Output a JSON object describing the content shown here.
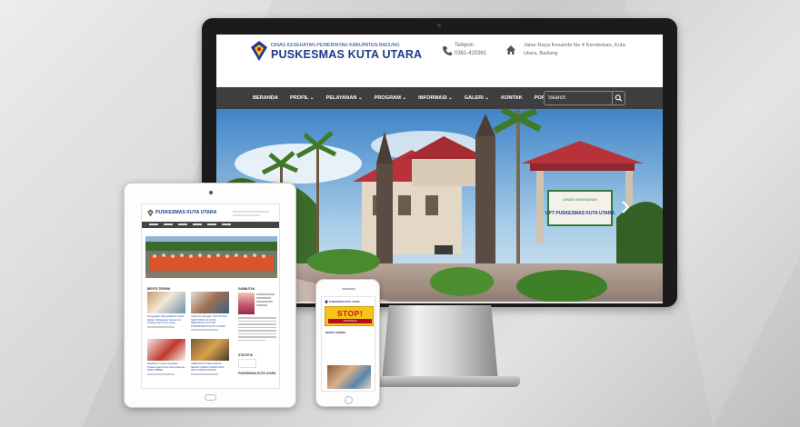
{
  "colors": {
    "brand_blue": "#1f3b88",
    "nav_bg": "#3e3e3e",
    "roof_red": "#b8323a",
    "stop_yellow": "#f2c41c",
    "stop_red": "#c8141c"
  },
  "desktop": {
    "header": {
      "kicker": "DINAS KESEHATAN PEMERINTAH KABUPATEN BADUNG",
      "title": "PUSKESMAS KUTA UTARA",
      "phone_label": "Telepon",
      "phone_number": "0361-425981",
      "address_line1": "Jalan Raya Kesambi No 4 Kerobokan, Kuta",
      "address_line2": "Utara, Badung",
      "phone_icon": "phone-icon",
      "address_icon": "home-icon"
    },
    "nav": {
      "items": [
        {
          "label": "BERANDA"
        },
        {
          "label": "PROFIL ⌄"
        },
        {
          "label": "PELAYANAN ⌄"
        },
        {
          "label": "PROGRAM ⌄"
        },
        {
          "label": "INFORMASI ⌄"
        },
        {
          "label": "GALERI ⌄"
        },
        {
          "label": "KONTAK"
        },
        {
          "label": "PORTAL"
        }
      ],
      "search_placeholder": "Search",
      "search_icon": "search-icon"
    },
    "hero": {
      "next_icon": "chevron-right-icon",
      "sign_top": "DINAS KESEHATAN",
      "sign_main": "UPT PUSKESMAS KUTA UTARA"
    }
  },
  "tablet": {
    "title": "PUSKESMAS KUTA UTARA",
    "section_title": "BERITA TERKINI",
    "side_title": "SAMBUTAN",
    "side_title2": "STATISTIK",
    "side_title3": "PUSKESMAS KUTA UTARA",
    "cards": [
      {
        "caption": "Pengadian Masyarakat Lansia dalam Pelayanan Senam di Puskesmas Kuta Utara"
      },
      {
        "caption": "Acara Kunjungan TIM LINTAS SEKTORAL di KUTA MENGKOLA DI UPT. PUSKESMAS KUTA UTARA"
      },
      {
        "caption": "Pelatihan Kerja Integritas Puskesmas Kuta Utara Menuju WBK WBBM"
      },
      {
        "caption": "VERIFIKASI KELUARGA SEHAT KERJA SAMA DAN PELAYANAN PRIMA"
      }
    ]
  },
  "phone": {
    "title": "PUSKESMAS KUTA UTARA",
    "banner_text": "STOP!",
    "banner_sub": "GRATIFIKASI",
    "section_title": "BERITA TERKINI"
  }
}
